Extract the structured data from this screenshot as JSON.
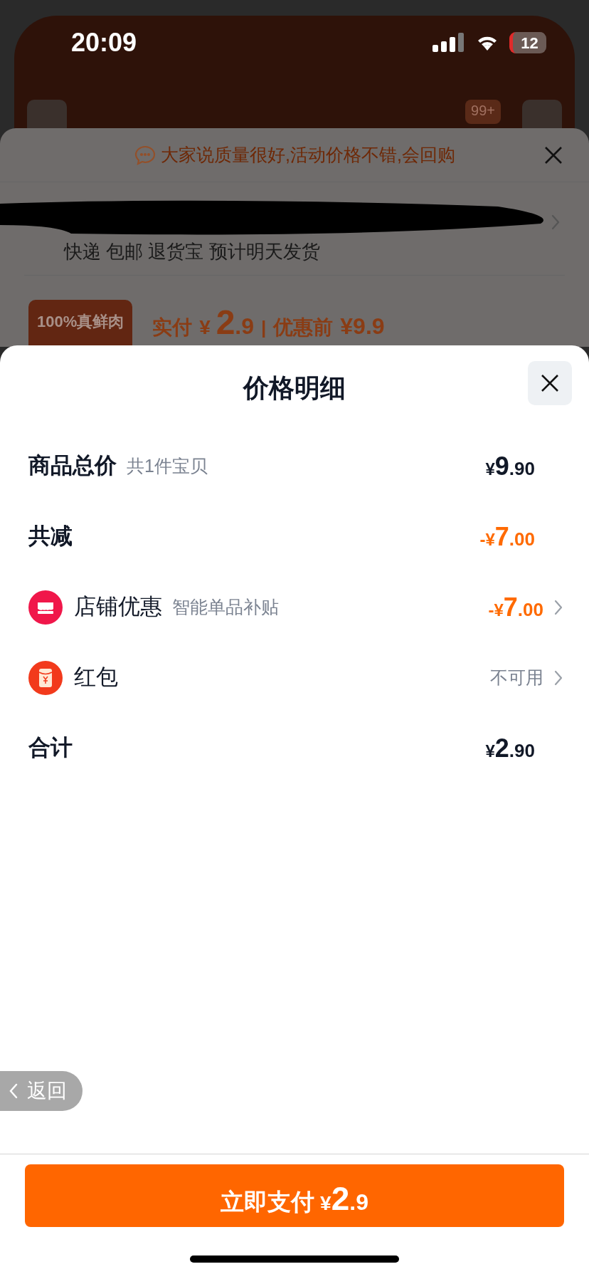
{
  "status_bar": {
    "time": "20:09",
    "battery": "12"
  },
  "background_page": {
    "badge": "99+",
    "review_banner": "大家说质量很好,活动价格不错,会回购",
    "shipping": "快递 包邮 退货宝 预计明天发货",
    "tag": "100%真鲜肉",
    "paid_label": "实付",
    "paid_price": {
      "sign": "¥",
      "int": "2",
      "dec": ".9"
    },
    "separator": "|",
    "before_label": "优惠前",
    "before_price": "¥9.9"
  },
  "sheet": {
    "title": "价格明细",
    "rows": [
      {
        "kind": "plain",
        "label": "商品总价",
        "bold": true,
        "note": "共1件宝贝",
        "price": {
          "sign": "¥",
          "int": "9",
          "dec": ".90"
        },
        "accent": false,
        "chevron": false
      },
      {
        "kind": "plain",
        "label": "共减",
        "bold": true,
        "price": {
          "sign": "-¥",
          "int": "7",
          "dec": ".00"
        },
        "accent": true,
        "chevron": false
      },
      {
        "kind": "shop",
        "label": "店铺优惠",
        "bold": false,
        "note": "智能单品补贴",
        "price": {
          "sign": "-¥",
          "int": "7",
          "dec": ".00"
        },
        "accent": true,
        "chevron": true
      },
      {
        "kind": "red_packet",
        "label": "红包",
        "bold": false,
        "status": "不可用",
        "chevron": true
      },
      {
        "kind": "plain",
        "label": "合计",
        "bold": true,
        "price": {
          "sign": "¥",
          "int": "2",
          "dec": ".90"
        },
        "accent": false,
        "chevron": false
      }
    ],
    "back_button": "返回",
    "pay_button": {
      "label": "立即支付",
      "price": {
        "sign": "¥",
        "int": "2",
        "dec": ".9"
      }
    }
  }
}
